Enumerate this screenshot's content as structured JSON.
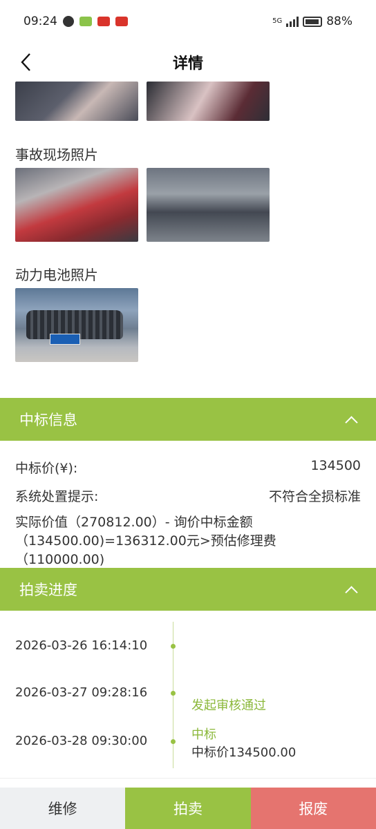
{
  "status_bar": {
    "time": "09:24",
    "network": "5G",
    "battery": "88%"
  },
  "nav": {
    "title": "详情"
  },
  "photos": {
    "accident_label": "事故现场照片",
    "battery_label": "动力电池照片"
  },
  "bid_info": {
    "header": "中标信息",
    "price_label": "中标价(¥):",
    "price_value": "134500",
    "hint_label": "系统处置提示:",
    "hint_value": "不符合全损标准",
    "note_line1": "实际价值（270812.00）- 询价中标金额",
    "note_line2": "（134500.00)=136312.00元>预估修理费（110000.00)"
  },
  "auction_progress": {
    "header": "拍卖进度",
    "items": [
      {
        "date": "2026-03-26 16:14:10",
        "title": "",
        "detail": ""
      },
      {
        "date": "2026-03-27 09:28:16",
        "title": "发起审核通过",
        "detail": ""
      },
      {
        "date": "2026-03-28 09:30:00",
        "title": "中标",
        "detail": "中标价134500.00"
      }
    ]
  },
  "actions": {
    "repair": "维修",
    "auction": "拍卖",
    "scrap": "报废"
  },
  "colors": {
    "accent": "#99c244",
    "scrap": "#e5746f",
    "repair_bg": "#eef0f2"
  }
}
